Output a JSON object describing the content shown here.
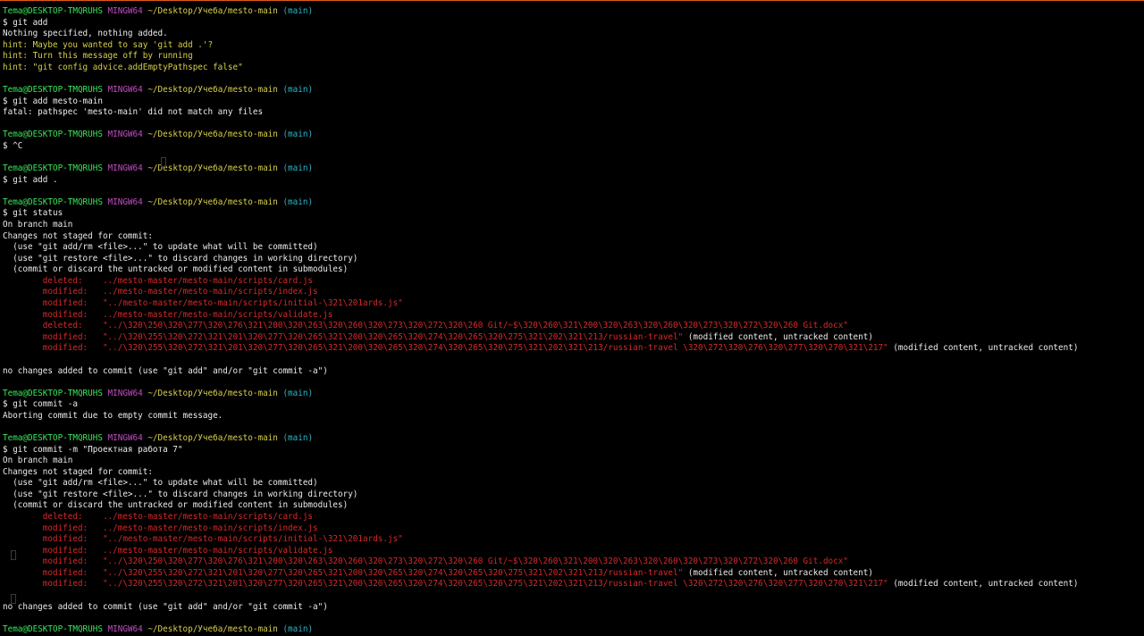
{
  "terminal": {
    "accent_color": "#e05a1a",
    "colors": {
      "user": "#39e65a",
      "host": "#c24ec2",
      "path": "#d6cf4a",
      "branch": "#2fb6c9",
      "changed": "#d42a2a",
      "text": "#ececec"
    },
    "lines": [
      [
        {
          "t": "Tema@DESKTOP-TMQRUHS ",
          "c": "green"
        },
        {
          "t": "MINGW64 ",
          "c": "magenta"
        },
        {
          "t": "~/Desktop/Учеба/mesto-main ",
          "c": "yellow"
        },
        {
          "t": "(main)",
          "c": "cyan"
        }
      ],
      [
        {
          "t": "$ git add",
          "c": "white"
        }
      ],
      [
        {
          "t": "Nothing specified, nothing added.",
          "c": "white"
        }
      ],
      [
        {
          "t": "hint: Maybe you wanted to say 'git add .'?",
          "c": "yellow"
        }
      ],
      [
        {
          "t": "hint: Turn this message off by running",
          "c": "yellow"
        }
      ],
      [
        {
          "t": "hint: \"git config advice.addEmptyPathspec false\"",
          "c": "yellow"
        }
      ],
      [],
      [
        {
          "t": "Tema@DESKTOP-TMQRUHS ",
          "c": "green"
        },
        {
          "t": "MINGW64 ",
          "c": "magenta"
        },
        {
          "t": "~/Desktop/Учеба/mesto-main ",
          "c": "yellow"
        },
        {
          "t": "(main)",
          "c": "cyan"
        }
      ],
      [
        {
          "t": "$ git add mesto-main",
          "c": "white"
        }
      ],
      [
        {
          "t": "fatal: pathspec 'mesto-main' did not match any files",
          "c": "white"
        }
      ],
      [],
      [
        {
          "t": "Tema@DESKTOP-TMQRUHS ",
          "c": "green"
        },
        {
          "t": "MINGW64 ",
          "c": "magenta"
        },
        {
          "t": "~/Desktop/Учеба/mesto-main ",
          "c": "yellow"
        },
        {
          "t": "(main)",
          "c": "cyan"
        }
      ],
      [
        {
          "t": "$ ^C",
          "c": "white"
        }
      ],
      [],
      [
        {
          "t": "Tema@DESKTOP-TMQRUHS ",
          "c": "green"
        },
        {
          "t": "MINGW64 ",
          "c": "magenta"
        },
        {
          "t": "~/Desktop/Учеба/mesto-main ",
          "c": "yellow"
        },
        {
          "t": "(main)",
          "c": "cyan"
        }
      ],
      [
        {
          "t": "$ git add .",
          "c": "white"
        }
      ],
      [],
      [
        {
          "t": "Tema@DESKTOP-TMQRUHS ",
          "c": "green"
        },
        {
          "t": "MINGW64 ",
          "c": "magenta"
        },
        {
          "t": "~/Desktop/Учеба/mesto-main ",
          "c": "yellow"
        },
        {
          "t": "(main)",
          "c": "cyan"
        }
      ],
      [
        {
          "t": "$ git status",
          "c": "white"
        }
      ],
      [
        {
          "t": "On branch main",
          "c": "white"
        }
      ],
      [
        {
          "t": "Changes not staged for commit:",
          "c": "white"
        }
      ],
      [
        {
          "t": "  (use \"git add/rm <file>...\" to update what will be committed)",
          "c": "white"
        }
      ],
      [
        {
          "t": "  (use \"git restore <file>...\" to discard changes in working directory)",
          "c": "white"
        }
      ],
      [
        {
          "t": "  (commit or discard the untracked or modified content in submodules)",
          "c": "white"
        }
      ],
      [
        {
          "t": "        deleted:    ../mesto-master/mesto-main/scripts/card.js",
          "c": "red"
        }
      ],
      [
        {
          "t": "        modified:   ../mesto-master/mesto-main/scripts/index.js",
          "c": "red"
        }
      ],
      [
        {
          "t": "        modified:   \"../mesto-master/mesto-main/scripts/initial-\\321\\201ards.js\"",
          "c": "red"
        }
      ],
      [
        {
          "t": "        modified:   ../mesto-master/mesto-main/scripts/validate.js",
          "c": "red"
        }
      ],
      [
        {
          "t": "        deleted:    \"../\\320\\250\\320\\277\\320\\276\\321\\200\\320\\263\\320\\260\\320\\273\\320\\272\\320\\260 Git/~$\\320\\260\\321\\200\\320\\263\\320\\260\\320\\273\\320\\272\\320\\260 Git.docx\"",
          "c": "red"
        }
      ],
      [
        {
          "t": "        modified:   \"../\\320\\255\\320\\272\\321\\201\\320\\277\\320\\265\\321\\200\\320\\265\\320\\274\\320\\265\\320\\275\\321\\202\\321\\213/russian-travel\"",
          "c": "red"
        },
        {
          "t": " (modified content, untracked content)",
          "c": "white"
        }
      ],
      [
        {
          "t": "        modified:   \"../\\320\\255\\320\\272\\321\\201\\320\\277\\320\\265\\321\\200\\320\\265\\320\\274\\320\\265\\320\\275\\321\\202\\321\\213/russian-travel \\320\\272\\320\\276\\320\\277\\320\\270\\321\\217\"",
          "c": "red"
        },
        {
          "t": " (modified content, untracked content)",
          "c": "white"
        }
      ],
      [],
      [
        {
          "t": "no changes added to commit (use \"git add\" and/or \"git commit -a\")",
          "c": "white"
        }
      ],
      [],
      [
        {
          "t": "Tema@DESKTOP-TMQRUHS ",
          "c": "green"
        },
        {
          "t": "MINGW64 ",
          "c": "magenta"
        },
        {
          "t": "~/Desktop/Учеба/mesto-main ",
          "c": "yellow"
        },
        {
          "t": "(main)",
          "c": "cyan"
        }
      ],
      [
        {
          "t": "$ git commit -a",
          "c": "white"
        }
      ],
      [
        {
          "t": "Aborting commit due to empty commit message.",
          "c": "white"
        }
      ],
      [],
      [
        {
          "t": "Tema@DESKTOP-TMQRUHS ",
          "c": "green"
        },
        {
          "t": "MINGW64 ",
          "c": "magenta"
        },
        {
          "t": "~/Desktop/Учеба/mesto-main ",
          "c": "yellow"
        },
        {
          "t": "(main)",
          "c": "cyan"
        }
      ],
      [
        {
          "t": "$ git commit -m \"Проектная работа 7\"",
          "c": "white"
        }
      ],
      [
        {
          "t": "On branch main",
          "c": "white"
        }
      ],
      [
        {
          "t": "Changes not staged for commit:",
          "c": "white"
        }
      ],
      [
        {
          "t": "  (use \"git add/rm <file>...\" to update what will be committed)",
          "c": "white"
        }
      ],
      [
        {
          "t": "  (use \"git restore <file>...\" to discard changes in working directory)",
          "c": "white"
        }
      ],
      [
        {
          "t": "  (commit or discard the untracked or modified content in submodules)",
          "c": "white"
        }
      ],
      [
        {
          "t": "        deleted:    ../mesto-master/mesto-main/scripts/card.js",
          "c": "red"
        }
      ],
      [
        {
          "t": "        modified:   ../mesto-master/mesto-main/scripts/index.js",
          "c": "red"
        }
      ],
      [
        {
          "t": "        modified:   \"../mesto-master/mesto-main/scripts/initial-\\321\\201ards.js\"",
          "c": "red"
        }
      ],
      [
        {
          "t": "        modified:   ../mesto-master/mesto-main/scripts/validate.js",
          "c": "red"
        }
      ],
      [
        {
          "t": "        modified:   \"../\\320\\250\\320\\277\\320\\276\\321\\200\\320\\263\\320\\260\\320\\273\\320\\272\\320\\260 Git/~$\\320\\260\\321\\200\\320\\263\\320\\260\\320\\273\\320\\272\\320\\260 Git.docx\"",
          "c": "red"
        }
      ],
      [
        {
          "t": "        modified:   \"../\\320\\255\\320\\272\\321\\201\\320\\277\\320\\265\\321\\200\\320\\265\\320\\274\\320\\265\\320\\275\\321\\202\\321\\213/russian-travel\"",
          "c": "red"
        },
        {
          "t": " (modified content, untracked content)",
          "c": "white"
        }
      ],
      [
        {
          "t": "        modified:   \"../\\320\\255\\320\\272\\321\\201\\320\\277\\320\\265\\321\\200\\320\\265\\320\\274\\320\\265\\320\\275\\321\\202\\321\\213/russian-travel \\320\\272\\320\\276\\320\\277\\320\\270\\321\\217\"",
          "c": "red"
        },
        {
          "t": " (modified content, untracked content)",
          "c": "white"
        }
      ],
      [],
      [
        {
          "t": "no changes added to commit (use \"git add\" and/or \"git commit -a\")",
          "c": "white"
        }
      ],
      [],
      [
        {
          "t": "Tema@DESKTOP-TMQRUHS ",
          "c": "green"
        },
        {
          "t": "MINGW64 ",
          "c": "magenta"
        },
        {
          "t": "~/Desktop/Учеба/mesto-main ",
          "c": "yellow"
        },
        {
          "t": "(main)",
          "c": "cyan"
        }
      ]
    ]
  }
}
